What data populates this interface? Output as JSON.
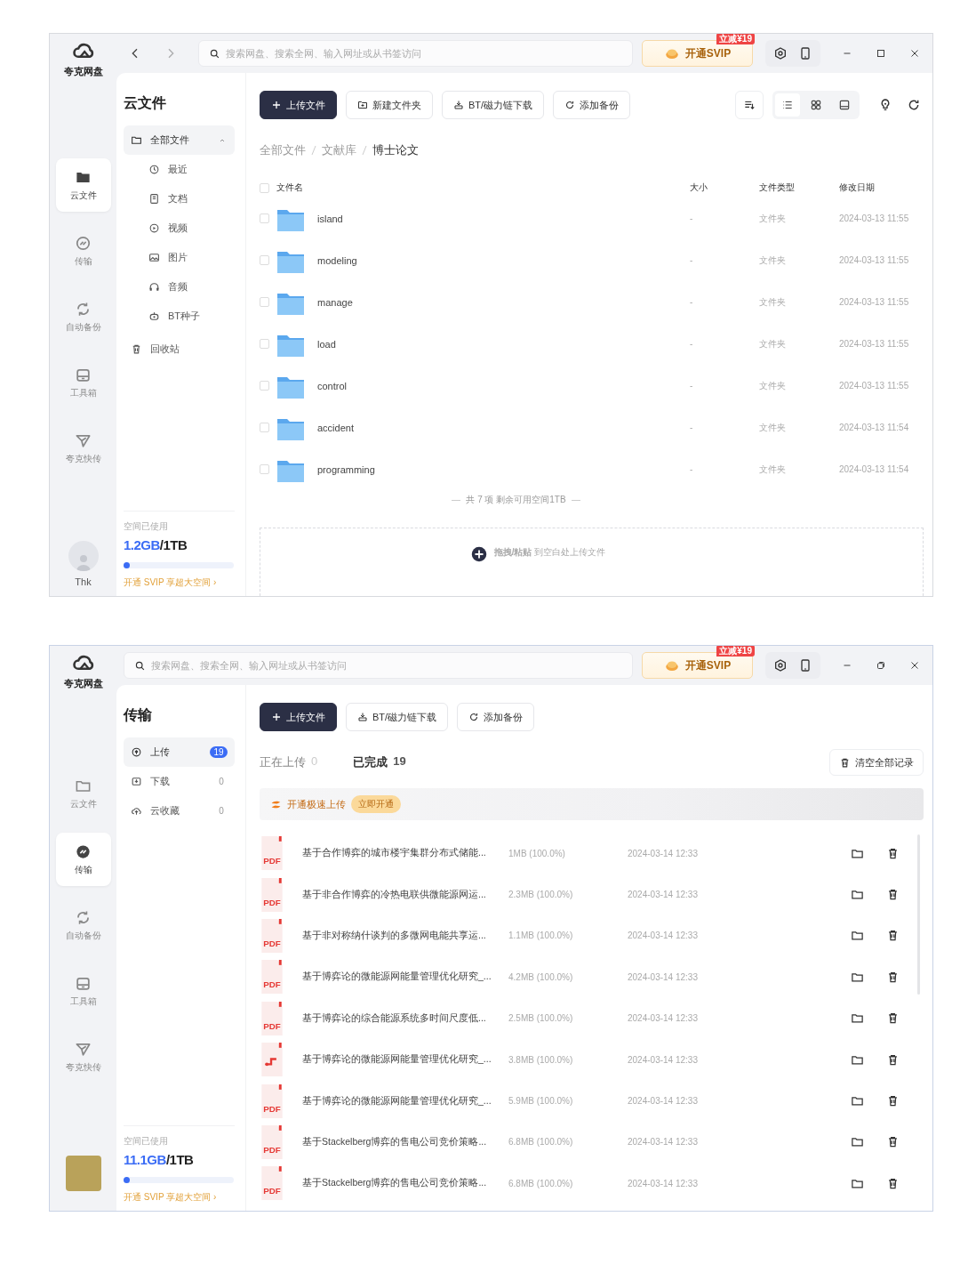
{
  "windows": [
    {
      "kind": "files",
      "logo_text": "夸克网盘",
      "search": {
        "placeholder": "搜索网盘、搜索全网、输入网址或从书签访问"
      },
      "svip": {
        "label": "开通SVIP",
        "badge": "立减¥19"
      },
      "maximized": false,
      "rail": [
        {
          "label": "云文件",
          "selected": true
        },
        {
          "label": "传输",
          "selected": false
        },
        {
          "label": "自动备份",
          "selected": false
        },
        {
          "label": "工具箱",
          "selected": false
        },
        {
          "label": "夸克快传",
          "selected": false
        }
      ],
      "user_name": "Thk",
      "panel": {
        "title": "云文件",
        "tree": [
          {
            "label": "全部文件",
            "selected": true,
            "expanded": true,
            "children": [
              {
                "label": "最近",
                "selected": false
              },
              {
                "label": "文档",
                "selected": false
              },
              {
                "label": "视频",
                "selected": false
              },
              {
                "label": "图片",
                "selected": false
              },
              {
                "label": "音频",
                "selected": false
              },
              {
                "label": "BT种子",
                "selected": false
              }
            ]
          },
          {
            "label": "回收站",
            "selected": false
          }
        ],
        "storage": {
          "label": "空间已使用",
          "used": "1.2GB",
          "total": "/1TB",
          "level": 0.06,
          "promo": "开通 SVIP 享超大空间 ›"
        }
      },
      "toolbar": [
        {
          "kind": "upload",
          "label": "上传文件"
        },
        {
          "kind": "new-folder",
          "label": "新建文件夹"
        },
        {
          "kind": "bt",
          "label": "BT/磁力链下载"
        },
        {
          "kind": "backup",
          "label": "添加备份"
        }
      ],
      "views": [
        {
          "selected": true
        },
        {
          "selected": false
        },
        {
          "selected": false
        }
      ],
      "breadcrumb": [
        "全部文件",
        "文献库",
        "博士论文"
      ],
      "table": {
        "all_checked": false,
        "columns": [
          "文件名",
          "大小",
          "文件类型",
          "修改日期"
        ],
        "rows": [
          {
            "name": "island",
            "size": "-",
            "type": "文件夹",
            "date": "2024-03-13 11:55",
            "checked": false
          },
          {
            "name": "modeling",
            "size": "-",
            "type": "文件夹",
            "date": "2024-03-13 11:55",
            "checked": false
          },
          {
            "name": "manage",
            "size": "-",
            "type": "文件夹",
            "date": "2024-03-13 11:55",
            "checked": false
          },
          {
            "name": "load",
            "size": "-",
            "type": "文件夹",
            "date": "2024-03-13 11:55",
            "checked": false
          },
          {
            "name": "control",
            "size": "-",
            "type": "文件夹",
            "date": "2024-03-13 11:55",
            "checked": false
          },
          {
            "name": "accident",
            "size": "-",
            "type": "文件夹",
            "date": "2024-03-13 11:54",
            "checked": false
          },
          {
            "name": "programming",
            "size": "-",
            "type": "文件夹",
            "date": "2024-03-13 11:54",
            "checked": false
          }
        ]
      },
      "summary": "共 7 项 剩余可用空间1TB",
      "drop_hint": "**拖拽/粘贴** 到空白处上传文件"
    },
    {
      "kind": "transfer",
      "logo_text": "夸克网盘",
      "search": {
        "placeholder": "搜索网盘、搜索全网、输入网址或从书签访问"
      },
      "svip": {
        "label": "开通SVIP",
        "badge": "立减¥19"
      },
      "maximized": true,
      "rail": [
        {
          "label": "云文件",
          "selected": false
        },
        {
          "label": "传输",
          "selected": true
        },
        {
          "label": "自动备份",
          "selected": false
        },
        {
          "label": "工具箱",
          "selected": false
        },
        {
          "label": "夸克快传",
          "selected": false
        }
      ],
      "panel": {
        "title": "传输",
        "items": [
          {
            "label": "上传",
            "count": "19",
            "selected": true
          },
          {
            "label": "下载",
            "count": "0",
            "selected": false
          },
          {
            "label": "云收藏",
            "count": "0",
            "selected": false
          }
        ],
        "storage": {
          "label": "空间已使用",
          "used": "11.1GB",
          "total": "/1TB",
          "level": 0.06,
          "promo": "开通 SVIP 享超大空间 ›"
        }
      },
      "toolbar": [
        {
          "kind": "upload",
          "label": "上传文件"
        },
        {
          "kind": "bt",
          "label": "BT/磁力链下载"
        },
        {
          "kind": "backup",
          "label": "添加备份"
        }
      ],
      "tabs": [
        {
          "label": "正在上传",
          "count": "0",
          "selected": false
        },
        {
          "label": "已完成",
          "count": "19",
          "selected": true
        }
      ],
      "clear_button": "清空全部记录",
      "banner": {
        "text": "开通极速上传",
        "button": "立即开通"
      },
      "transfers": [
        {
          "kind": "pdf",
          "label": "PDF",
          "name": "基于合作博弈的城市楼宇集群分布式储能...",
          "size": "1MB (100.0%)",
          "date": "2024-03-14 12:33"
        },
        {
          "kind": "pdf",
          "label": "PDF",
          "name": "基于非合作博弈的冷热电联供微能源网运...",
          "size": "2.3MB (100.0%)",
          "date": "2024-03-14 12:33"
        },
        {
          "kind": "pdf",
          "label": "PDF",
          "name": "基于非对称纳什谈判的多微网电能共享运...",
          "size": "1.1MB (100.0%)",
          "date": "2024-03-14 12:33"
        },
        {
          "kind": "pdf",
          "label": "PDF",
          "name": "基于博弈论的微能源网能量管理优化研究_...",
          "size": "4.2MB (100.0%)",
          "date": "2024-03-14 12:33"
        },
        {
          "kind": "pdf",
          "label": "PDF",
          "name": "基于博弈论的综合能源系统多时间尺度低...",
          "size": "2.5MB (100.0%)",
          "date": "2024-03-14 12:33"
        },
        {
          "kind": "other",
          "name": "基于博弈论的微能源网能量管理优化研究_...",
          "size": "3.8MB (100.0%)",
          "date": "2024-03-14 12:33"
        },
        {
          "kind": "pdf",
          "label": "PDF",
          "name": "基于博弈论的微能源网能量管理优化研究_...",
          "size": "5.9MB (100.0%)",
          "date": "2024-03-14 12:33"
        },
        {
          "kind": "pdf",
          "label": "PDF",
          "name": "基于Stackelberg博弈的售电公司竞价策略...",
          "size": "6.8MB (100.0%)",
          "date": "2024-03-14 12:33"
        },
        {
          "kind": "pdf",
          "label": "PDF",
          "name": "基于Stackelberg博弈的售电公司竞价策略...",
          "size": "6.8MB (100.0%)",
          "date": "2024-03-14 12:33"
        }
      ]
    }
  ]
}
